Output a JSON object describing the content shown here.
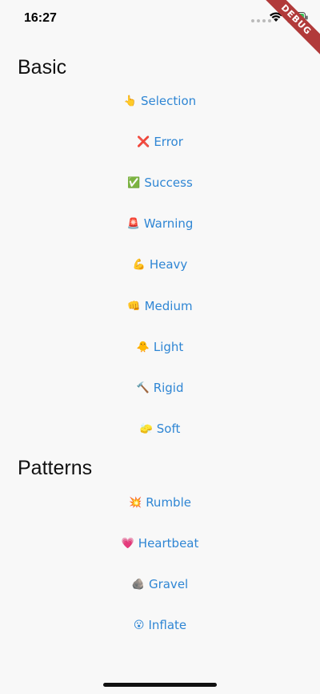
{
  "status_bar": {
    "time": "16:27"
  },
  "debug_banner": "DEBUG",
  "sections": {
    "basic": {
      "title": "Basic",
      "items": [
        {
          "emoji": "👆",
          "label": "Selection"
        },
        {
          "emoji": "❌",
          "label": "Error"
        },
        {
          "emoji": "✅",
          "label": "Success"
        },
        {
          "emoji": "🚨",
          "label": "Warning"
        },
        {
          "emoji": "💪",
          "label": "Heavy"
        },
        {
          "emoji": "👊",
          "label": "Medium"
        },
        {
          "emoji": "🐥",
          "label": "Light"
        },
        {
          "emoji": "🔨",
          "label": "Rigid"
        },
        {
          "emoji": "🧽",
          "label": "Soft"
        }
      ]
    },
    "patterns": {
      "title": "Patterns",
      "items": [
        {
          "emoji": "💥",
          "label": "Rumble"
        },
        {
          "emoji": "💗",
          "label": "Heartbeat"
        },
        {
          "emoji": "🪨",
          "label": "Gravel"
        },
        {
          "emoji": "😮",
          "label": "Inflate"
        }
      ]
    }
  },
  "colors": {
    "link": "#2f86d4",
    "background": "#f8f8f8",
    "debug_ribbon": "#b13a3a"
  }
}
